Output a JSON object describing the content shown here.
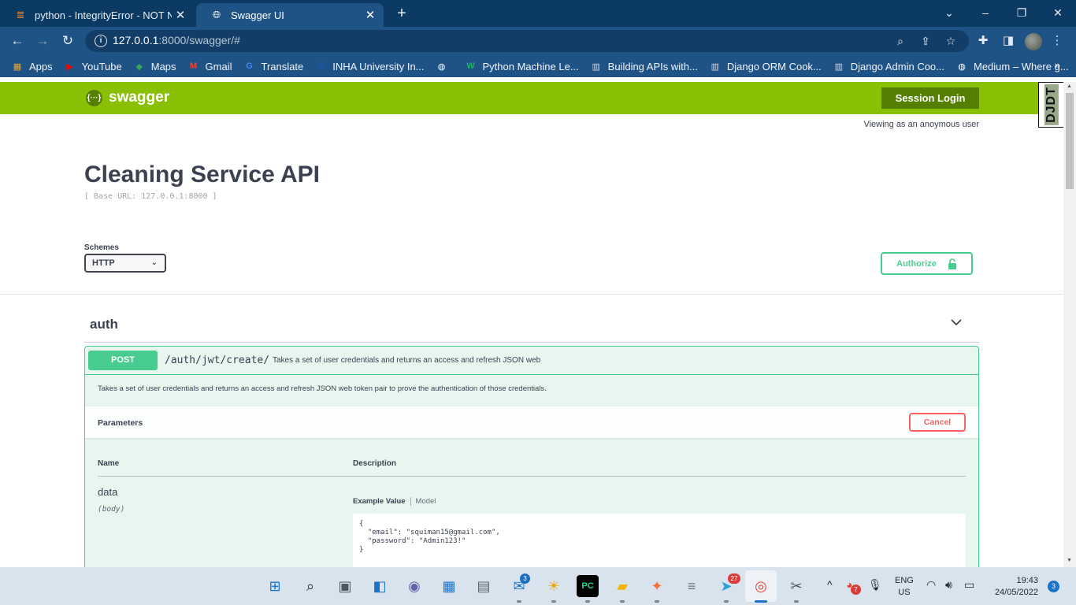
{
  "browser": {
    "tabs": [
      {
        "title": "python - IntegrityError - NOT NU",
        "close": "✕"
      },
      {
        "title": "Swagger UI",
        "close": "✕"
      }
    ],
    "new_tab": "+",
    "window_controls": {
      "minimize": "⌄",
      "restore": "–",
      "maximize": "❐",
      "close": "✕"
    },
    "url_host": "127.0.0.1",
    "url_rest": ":8000/swagger/#",
    "bookmarks": [
      {
        "label": "Apps",
        "icon": "apps-grid-icon",
        "color": "#e8a53a"
      },
      {
        "label": "YouTube",
        "icon": "youtube-icon",
        "color": "#ff0000"
      },
      {
        "label": "Maps",
        "icon": "maps-icon",
        "color": "#34a853"
      },
      {
        "label": "Gmail",
        "icon": "gmail-icon",
        "color": "#ea4335"
      },
      {
        "label": "Translate",
        "icon": "translate-icon",
        "color": "#4285f4"
      },
      {
        "label": "INHA University In...",
        "icon": "inha-icon",
        "color": "#1a56b0"
      },
      {
        "label": "",
        "icon": "globe-icon",
        "color": "#ffffff"
      },
      {
        "label": "Python Machine Le...",
        "icon": "w-logo-icon",
        "color": "#20b26b"
      },
      {
        "label": "Building APIs with...",
        "icon": "book-icon",
        "color": "#cfd6de"
      },
      {
        "label": "Django ORM Cook...",
        "icon": "book-icon",
        "color": "#cfd6de"
      },
      {
        "label": "Django Admin Coo...",
        "icon": "book-icon",
        "color": "#cfd6de"
      },
      {
        "label": "Medium – Where g...",
        "icon": "globe-icon",
        "color": "#ffffff"
      }
    ],
    "bookmarks_more": "»"
  },
  "swagger": {
    "logo_text": "swagger",
    "logo_mark": "{···}",
    "session_login": "Session Login",
    "djdt": "DJDT",
    "viewing_as": "Viewing as an anoymous user",
    "title": "Cleaning Service API",
    "base_url": "[ Base URL: 127.0.0.1:8000 ]",
    "schemes_label": "Schemes",
    "scheme_value": "HTTP",
    "authorize": "Authorize",
    "tag": "auth",
    "operation": {
      "method": "POST",
      "path": "/auth/jwt/create/",
      "summary": "Takes a set of user credentials and returns an access and refresh JSON web",
      "description": "Takes a set of user credentials and returns an access and refresh JSON web token pair to prove the authentication of those credentials.",
      "parameters_title": "Parameters",
      "cancel": "Cancel",
      "col_name": "Name",
      "col_description": "Description",
      "param_name": "data",
      "param_in": "(body)",
      "example_tab": "Example Value",
      "model_tab": "Model",
      "example_json": "{\n  \"email\": \"squiman15@gmail.com\",\n  \"password\": \"Admin123!\"\n}"
    }
  },
  "taskbar": {
    "apps": [
      {
        "name": "start-icon",
        "glyph": "⊞",
        "color": "#1a73c8"
      },
      {
        "name": "search-icon",
        "glyph": "⌕",
        "color": "#1c2733"
      },
      {
        "name": "task-view-icon",
        "glyph": "▣",
        "color": "#4a5560"
      },
      {
        "name": "widgets-icon",
        "glyph": "◧",
        "color": "#1a73c8"
      },
      {
        "name": "teams-chat-icon",
        "glyph": "◉",
        "color": "#6264a7"
      },
      {
        "name": "store-icon",
        "glyph": "▦",
        "color": "#1a73c8"
      },
      {
        "name": "calculator-icon",
        "glyph": "▤",
        "color": "#5a6570"
      },
      {
        "name": "mail-icon",
        "glyph": "✉",
        "color": "#1a73c8"
      },
      {
        "name": "weather-icon",
        "glyph": "☀",
        "color": "#f0a500"
      },
      {
        "name": "pycharm-icon",
        "glyph": "PC",
        "color": "#21d789"
      },
      {
        "name": "file-explorer-icon",
        "glyph": "▰",
        "color": "#f2b600"
      },
      {
        "name": "postman-icon",
        "glyph": "✦",
        "color": "#ff6c37"
      },
      {
        "name": "database-icon",
        "glyph": "≡",
        "color": "#6d7680"
      },
      {
        "name": "telegram-icon",
        "glyph": "➤",
        "color": "#2aa1da"
      },
      {
        "name": "chrome-icon",
        "glyph": "◎",
        "color": "#db4437"
      },
      {
        "name": "snipping-tool-icon",
        "glyph": "✂",
        "color": "#4a5560"
      }
    ],
    "mail_badge": "3",
    "telegram_badge": "27",
    "tray_badge": "7",
    "language": {
      "line1": "ENG",
      "line2": "US"
    },
    "time": "19:43",
    "date": "24/05/2022",
    "notifications": "3"
  }
}
